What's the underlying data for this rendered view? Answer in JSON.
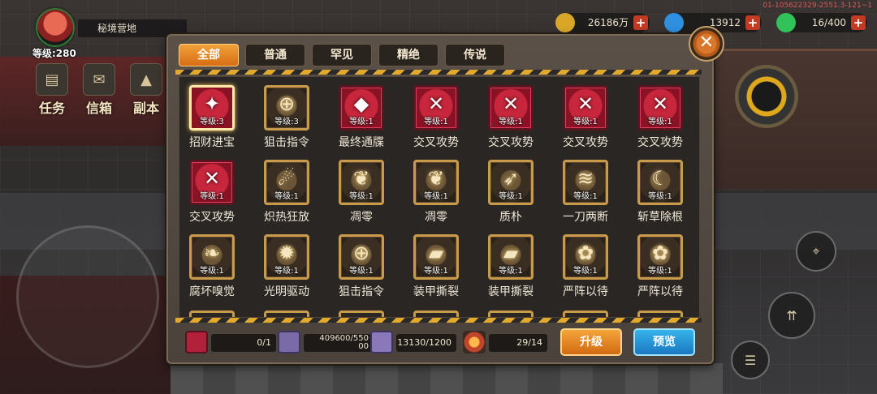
{
  "player": {
    "zone_name": "秘境营地",
    "level": "等级:280"
  },
  "side_menu": [
    {
      "label": "任务",
      "icon": "scroll-icon"
    },
    {
      "label": "信箱",
      "icon": "mailbox-icon"
    },
    {
      "label": "副本",
      "icon": "dungeon-icon"
    }
  ],
  "currencies": [
    {
      "name": "gold",
      "value": "26186万",
      "color": "#d9a627"
    },
    {
      "name": "gem",
      "value": "13912",
      "color": "#2f8fe0"
    },
    {
      "name": "energy",
      "value": "16/400",
      "color": "#32c25a"
    }
  ],
  "build_id": "01-105622329-2551.3-121~1",
  "close_label": "✕",
  "tabs": [
    "全部",
    "普通",
    "罕见",
    "精绝",
    "传说"
  ],
  "active_tab": "全部",
  "skills": [
    {
      "name": "招财进宝",
      "level": "等级:3",
      "frame": "red",
      "glyph": "✦",
      "selected": true
    },
    {
      "name": "狙击指令",
      "level": "等级:3",
      "frame": "gold",
      "glyph": "⊕"
    },
    {
      "name": "最终通牒",
      "level": "等级:1",
      "frame": "red",
      "glyph": "◆"
    },
    {
      "name": "交叉攻势",
      "level": "等级:1",
      "frame": "red",
      "glyph": "✕"
    },
    {
      "name": "交叉攻势",
      "level": "等级:1",
      "frame": "red",
      "glyph": "✕"
    },
    {
      "name": "交叉攻势",
      "level": "等级:1",
      "frame": "red",
      "glyph": "✕"
    },
    {
      "name": "交叉攻势",
      "level": "等级:1",
      "frame": "red",
      "glyph": "✕"
    },
    {
      "name": "交叉攻势",
      "level": "等级:1",
      "frame": "red",
      "glyph": "✕"
    },
    {
      "name": "炽热狂放",
      "level": "等级:1",
      "frame": "gold",
      "glyph": "☄"
    },
    {
      "name": "凋零",
      "level": "等级:1",
      "frame": "gold",
      "glyph": "❦"
    },
    {
      "name": "凋零",
      "level": "等级:1",
      "frame": "gold",
      "glyph": "❦"
    },
    {
      "name": "质朴",
      "level": "等级:1",
      "frame": "gold",
      "glyph": "➶"
    },
    {
      "name": "一刀两断",
      "level": "等级:1",
      "frame": "gold",
      "glyph": "≋"
    },
    {
      "name": "斩草除根",
      "level": "等级:1",
      "frame": "gold",
      "glyph": "☾"
    },
    {
      "name": "腐坏嗅觉",
      "level": "等级:1",
      "frame": "gold",
      "glyph": "❧"
    },
    {
      "name": "光明驱动",
      "level": "等级:1",
      "frame": "gold",
      "glyph": "✹"
    },
    {
      "name": "狙击指令",
      "level": "等级:1",
      "frame": "gold",
      "glyph": "⊕"
    },
    {
      "name": "装甲撕裂",
      "level": "等级:1",
      "frame": "gold",
      "glyph": "▰"
    },
    {
      "name": "装甲撕裂",
      "level": "等级:1",
      "frame": "gold",
      "glyph": "▰"
    },
    {
      "name": "严阵以待",
      "level": "等级:1",
      "frame": "gold",
      "glyph": "✿"
    },
    {
      "name": "严阵以待",
      "level": "等级:1",
      "frame": "gold",
      "glyph": "✿"
    }
  ],
  "resources": [
    {
      "name": "skill-token",
      "value": "0/1",
      "color": "#b3203a"
    },
    {
      "name": "tech-book-blue",
      "value": "409600/550\n00",
      "color": "#7a6aa8"
    },
    {
      "name": "tech-book-purple",
      "value": "13130/1200",
      "color": "#8a78b8"
    },
    {
      "name": "orb",
      "value": "29/14",
      "color": "#c0452a"
    }
  ],
  "buttons": {
    "upgrade": "升级",
    "preview": "预览"
  }
}
